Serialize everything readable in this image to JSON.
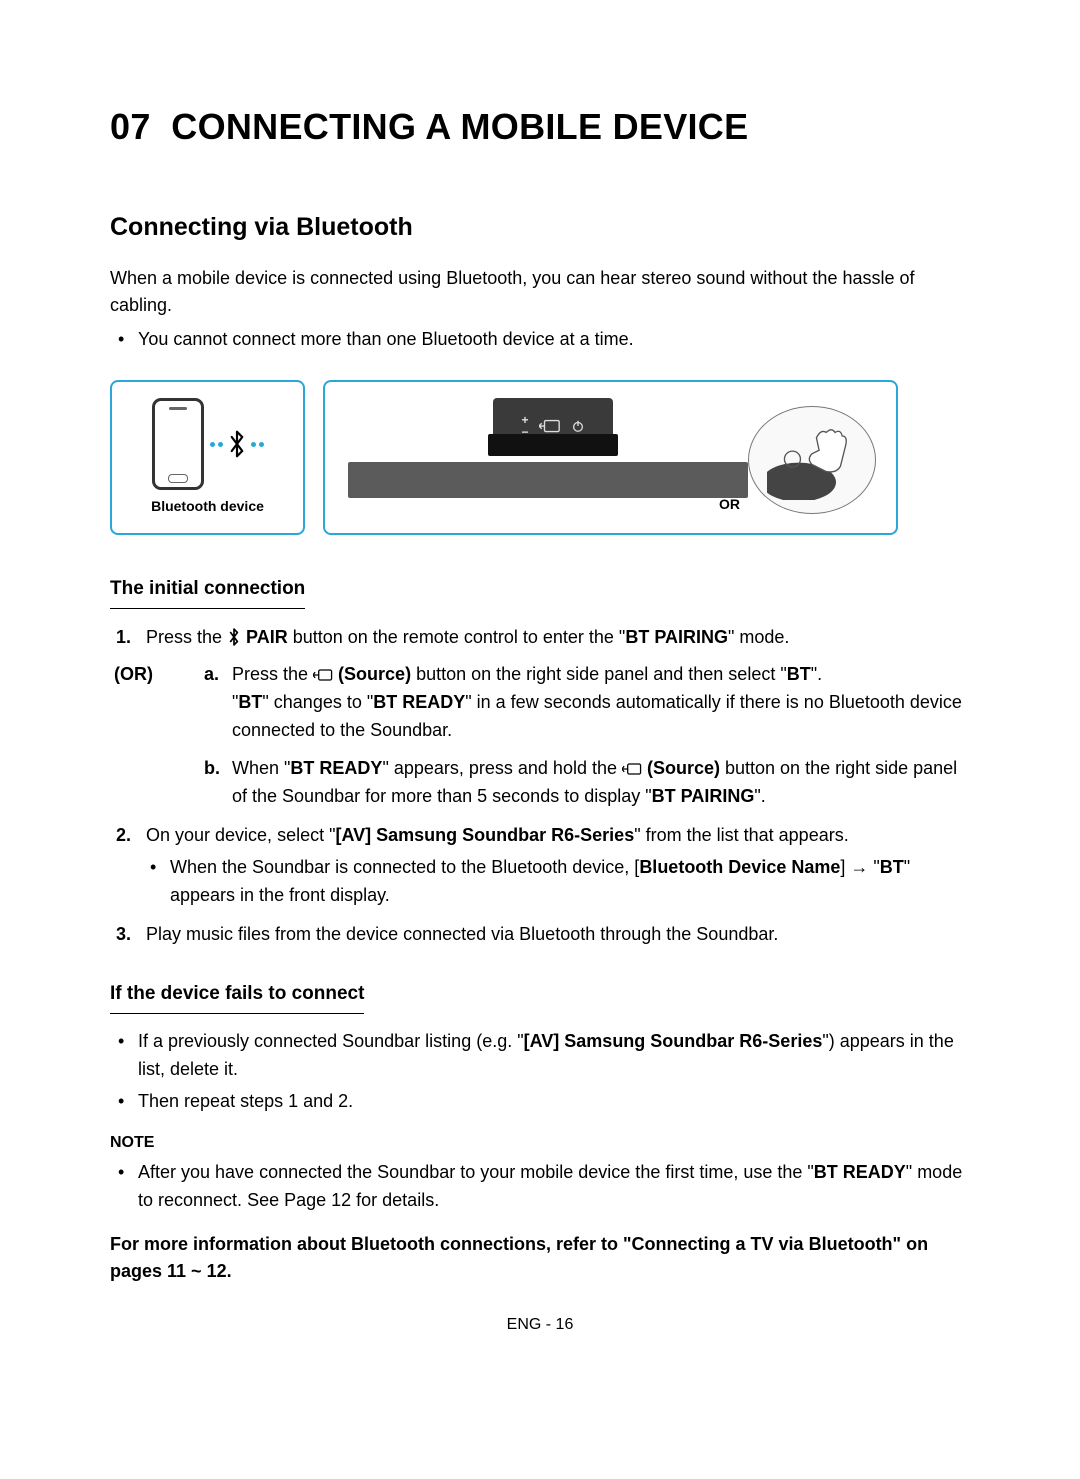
{
  "header": {
    "number": "07",
    "title": "CONNECTING A MOBILE DEVICE"
  },
  "section": {
    "subtitle": "Connecting via Bluetooth",
    "intro": "When a mobile device is connected using Bluetooth, you can hear stereo sound without the hassle of cabling.",
    "bullet1": "You cannot connect more than one Bluetooth device at a time."
  },
  "figure": {
    "caption_left": "Bluetooth device",
    "or_label": "OR"
  },
  "initial": {
    "heading": "The initial connection",
    "step1_num": "1.",
    "step1_a": "Press the ",
    "step1_pair": " PAIR",
    "step1_b": " button on the remote control to enter the \"",
    "step1_mode": "BT PAIRING",
    "step1_c": "\" mode.",
    "or_tag": "(OR)",
    "a_let": "a.",
    "a_1": "Press the ",
    "a_src": " (Source)",
    "a_2": " button on the right side panel and then select \"",
    "a_bt": "BT",
    "a_3": "\".",
    "a_line2_pre": "\"",
    "a_line2_bt": "BT",
    "a_line2_mid": "\" changes to \"",
    "a_line2_ready": "BT READY",
    "a_line2_post": "\" in a few seconds automatically if there is no Bluetooth device connected to the Soundbar.",
    "b_let": "b.",
    "b_1": "When \"",
    "b_ready": "BT READY",
    "b_2": "\" appears, press and hold the ",
    "b_src": " (Source)",
    "b_3": " button on the right side panel of the Soundbar for more than 5 seconds to display \"",
    "b_pairing": "BT PAIRING",
    "b_4": "\".",
    "step2_num": "2.",
    "step2_a": "On your device, select \"",
    "step2_dev": "[AV] Samsung Soundbar R6-Series",
    "step2_b": "\" from the list that appears.",
    "step2_sub_a": "When the Soundbar is connected to the Bluetooth device, [",
    "step2_sub_name": "Bluetooth Device Name",
    "step2_sub_b": "] → \"",
    "step2_sub_bt": "BT",
    "step2_sub_c": "\" appears in the front display.",
    "step3_num": "3.",
    "step3": "Play music files from the device connected via Bluetooth through the Soundbar."
  },
  "fails": {
    "heading": "If the device fails to connect",
    "b1_a": "If a previously connected Soundbar listing (e.g. \"",
    "b1_dev": "[AV] Samsung Soundbar R6-Series",
    "b1_b": "\") appears in the list, delete it.",
    "b2": "Then repeat steps 1 and 2."
  },
  "note": {
    "heading": "NOTE",
    "b1_a": "After you have connected the Soundbar to your mobile device the first time, use the \"",
    "b1_ready": "BT READY",
    "b1_b": "\" mode to reconnect. See Page 12 for details."
  },
  "footer_ref": "For more information about Bluetooth connections, refer to \"Connecting a TV via Bluetooth\" on pages 11 ~ 12.",
  "page_num": "ENG - 16"
}
